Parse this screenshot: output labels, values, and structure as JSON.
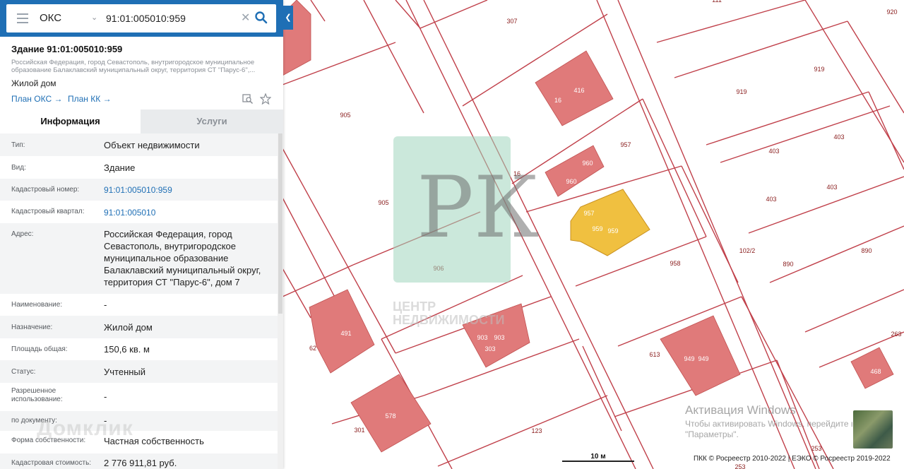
{
  "search": {
    "type": "ОКС",
    "value": "91:01:005010:959"
  },
  "object": {
    "title": "Здание 91:01:005010:959",
    "address_short": "Российская Федерация, город Севастополь, внутригородское муниципальное образование Балаклавский муниципальный округ, территория СТ \"Парус-6\",...",
    "kind": "Жилой дом",
    "plan_oks": "План ОКС",
    "plan_kk": "План КК"
  },
  "tabs": {
    "info": "Информация",
    "services": "Услуги"
  },
  "rows": [
    {
      "k": "Тип:",
      "v": "Объект недвижимости"
    },
    {
      "k": "Вид:",
      "v": "Здание"
    },
    {
      "k": "Кадастровый номер:",
      "v": "91:01:005010:959"
    },
    {
      "k": "Кадастровый квартал:",
      "v": "91:01:005010"
    },
    {
      "k": "Адрес:",
      "v": "Российская Федерация, город Севастополь, внутригородское муниципальное образование Балаклавский муниципальный округ, территория СТ \"Парус-6\", дом 7"
    },
    {
      "k": "Наименование:",
      "v": "-"
    },
    {
      "k": "Назначение:",
      "v": "Жилой дом"
    },
    {
      "k": "Площадь общая:",
      "v": "150,6 кв. м"
    },
    {
      "k": "Статус:",
      "v": "Учтенный"
    },
    {
      "k": "Разрешенное использование:",
      "v": "-"
    },
    {
      "k": "по документу:",
      "v": "-"
    },
    {
      "k": "Форма собственности:",
      "v": "Частная собственность"
    },
    {
      "k": "Кадастровая стоимость:",
      "v": "2 776 911,81 руб."
    }
  ],
  "map": {
    "parcel_labels": [
      "307",
      "111",
      "920",
      "919",
      "919",
      "905",
      "957",
      "16",
      "403",
      "403",
      "403",
      "403",
      "905",
      "906",
      "958",
      "102/2",
      "890",
      "890",
      "263",
      "613",
      "123",
      "301",
      "62",
      "253",
      "253"
    ],
    "building_labels": [
      "416",
      "16",
      "960",
      "960",
      "957",
      "959",
      "959",
      "491",
      "903",
      "903",
      "303",
      "578",
      "949",
      "949",
      "468"
    ],
    "colors": {
      "parcel_line": "#c0404a",
      "building": "#e07a7a",
      "selected": "#f0c040"
    }
  },
  "watermark": {
    "letters": "РК",
    "text": "ЦЕНТР НЕДВИЖИМОСТИ",
    "domclick": "Домклик"
  },
  "windows": {
    "title": "Активация Windows",
    "subtitle": "Чтобы активировать Windows, перейдите в раздел \"Параметры\"."
  },
  "scale": "10 м",
  "copyright": "ПКК © Росреестр 2010-2022 | ЕЭКО © Росреестр 2019-2022"
}
